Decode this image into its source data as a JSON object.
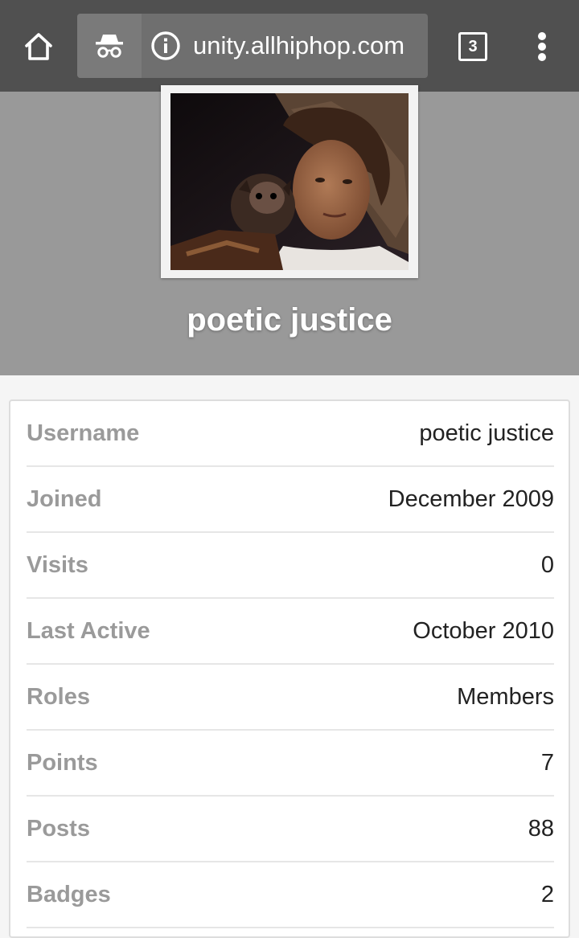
{
  "browser": {
    "url": "unity.allhiphop.com",
    "tab_count": "3",
    "icons": {
      "home": "home-icon",
      "incognito": "incognito-icon",
      "site_info": "info-icon",
      "tabs": "tab-switcher-icon",
      "menu": "more-vert-icon"
    }
  },
  "profile": {
    "name": "poetic justice",
    "photo": "profile-photo"
  },
  "details": [
    {
      "label": "Username",
      "value": "poetic justice"
    },
    {
      "label": "Joined",
      "value": "December 2009"
    },
    {
      "label": "Visits",
      "value": "0"
    },
    {
      "label": "Last Active",
      "value": "October 2010"
    },
    {
      "label": "Roles",
      "value": "Members"
    },
    {
      "label": "Points",
      "value": "7"
    },
    {
      "label": "Posts",
      "value": "88"
    },
    {
      "label": "Badges",
      "value": "2"
    }
  ],
  "colors": {
    "toolbar": "#505050",
    "omnibox": "#6f6f6f",
    "header": "#999999",
    "label": "#9a9a9a",
    "value": "#222222"
  }
}
